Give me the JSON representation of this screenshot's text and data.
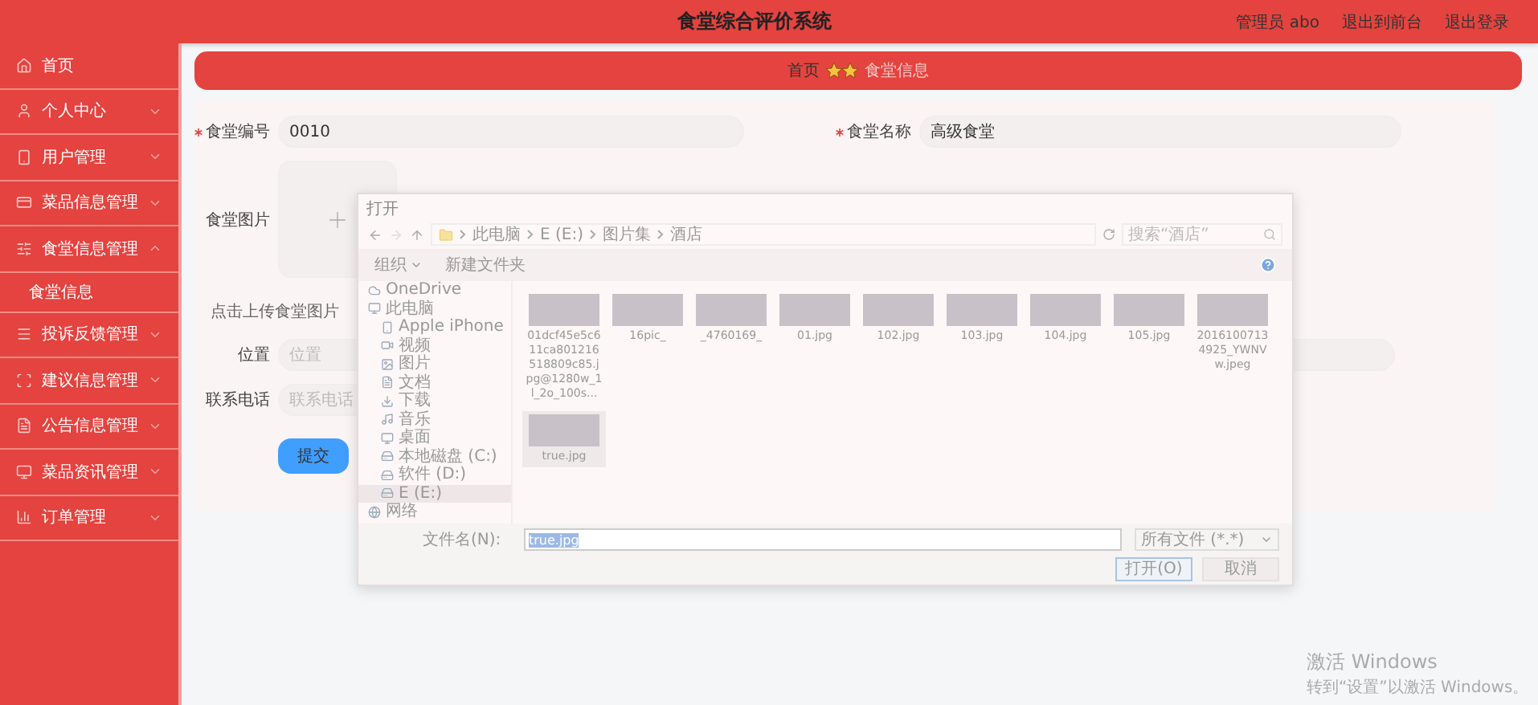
{
  "header": {
    "title": "食堂综合评价系统",
    "user": "管理员 abo",
    "links": [
      "退出到前台",
      "退出登录"
    ]
  },
  "sidebar": {
    "items": [
      {
        "label": "首页",
        "kind": "link"
      },
      {
        "label": "个人中心",
        "kind": "menu",
        "expanded": false
      },
      {
        "label": "用户管理",
        "kind": "menu",
        "expanded": false
      },
      {
        "label": "菜品信息管理",
        "kind": "menu",
        "expanded": false
      },
      {
        "label": "食堂信息管理",
        "kind": "menu",
        "expanded": true,
        "children": [
          {
            "label": "食堂信息"
          }
        ]
      },
      {
        "label": "投诉反馈管理",
        "kind": "menu",
        "expanded": false
      },
      {
        "label": "建议信息管理",
        "kind": "menu",
        "expanded": false
      },
      {
        "label": "公告信息管理",
        "kind": "menu",
        "expanded": false
      },
      {
        "label": "菜品资讯管理",
        "kind": "menu",
        "expanded": false
      },
      {
        "label": "订单管理",
        "kind": "menu",
        "expanded": false
      }
    ]
  },
  "breadcrumb": [
    {
      "label": "首页",
      "selected": false
    },
    {
      "label": "食堂信息",
      "selected": true
    }
  ],
  "form": {
    "fields": [
      {
        "label": "食堂编号",
        "required": true,
        "value": "0010"
      },
      {
        "label": "食堂名称",
        "required": true,
        "value": "高级食堂"
      }
    ],
    "image": {
      "label": "食堂图片",
      "hint": "点击上传食堂图片"
    },
    "location": {
      "label": "位置",
      "placeholder": "位置"
    },
    "phone": {
      "label": "联系电话",
      "placeholder": "联系电话"
    },
    "submit": "提交"
  },
  "dialog": {
    "title": "打开",
    "path": [
      "此电脑",
      "E (E:)",
      "图片集",
      "酒店"
    ],
    "search": {
      "placeholder": "搜索“酒店”"
    },
    "toolbar": {
      "organize": "组织",
      "new_folder": "新建文件夹"
    },
    "tree": [
      {
        "label": "OneDrive",
        "selected": false
      },
      {
        "label": "此电脑",
        "selected": false,
        "children": [
          {
            "label": "Apple iPhone",
            "selected": false
          },
          {
            "label": "视频",
            "selected": false
          },
          {
            "label": "图片",
            "selected": false
          },
          {
            "label": "文档",
            "selected": false
          },
          {
            "label": "下载",
            "selected": false
          },
          {
            "label": "音乐",
            "selected": false
          },
          {
            "label": "桌面",
            "selected": false
          },
          {
            "label": "本地磁盘 (C:)",
            "selected": false
          },
          {
            "label": "软件 (D:)",
            "selected": false
          },
          {
            "label": "E (E:)",
            "selected": true
          }
        ]
      },
      {
        "label": "网络",
        "selected": false
      }
    ],
    "files": [
      {
        "name": "01dcf45e5c611ca801216518809c85.jpg@1280w_1l_2o_100s...",
        "selected": false
      },
      {
        "name": "16pic_",
        "selected": false
      },
      {
        "name": "_4760169_",
        "selected": false
      },
      {
        "name": "01.jpg",
        "selected": false
      },
      {
        "name": "102.jpg",
        "selected": false
      },
      {
        "name": "103.jpg",
        "selected": false
      },
      {
        "name": "104.jpg",
        "selected": false
      },
      {
        "name": "105.jpg",
        "selected": false
      },
      {
        "name": "20161007134925_YWNVw.jpeg",
        "selected": false
      },
      {
        "name": "true.jpg",
        "selected": true
      }
    ],
    "filename": {
      "label": "文件名(N):",
      "value": "true.jpg"
    },
    "filetype": "所有文件 (*.*)",
    "buttons": [
      "打开(O)",
      "取消"
    ]
  },
  "activation": {
    "title": "激活 Windows",
    "hint": "转到“设置”以激活 Windows。"
  }
}
